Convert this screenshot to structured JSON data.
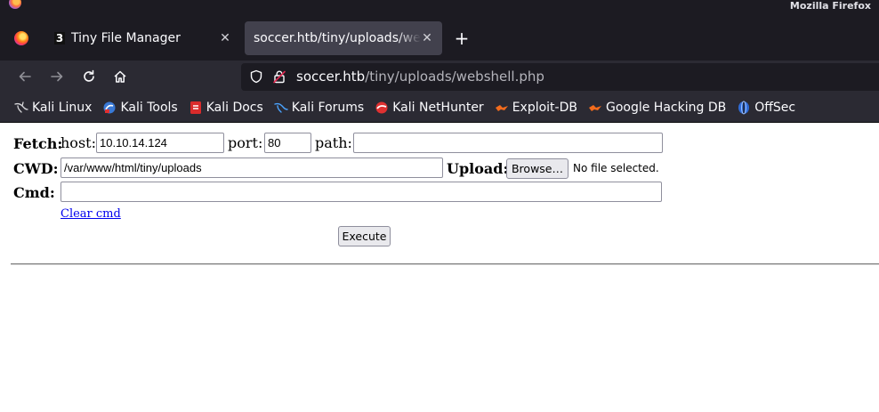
{
  "browser": {
    "app_title": "Mozilla Firefox",
    "tabs": [
      {
        "label": "Tiny File Manager",
        "favicon": "3",
        "active": false
      },
      {
        "label": "soccer.htb/tiny/uploads/webshell.php",
        "active": true
      }
    ],
    "url_host": "soccer.htb",
    "url_path": "/tiny/uploads/webshell.php",
    "bookmarks": [
      {
        "label": "Kali Linux",
        "icon": "kali-dragon-icon"
      },
      {
        "label": "Kali Tools",
        "icon": "kali-tools-icon"
      },
      {
        "label": "Kali Docs",
        "icon": "kali-docs-icon"
      },
      {
        "label": "Kali Forums",
        "icon": "kali-forums-icon"
      },
      {
        "label": "Kali NetHunter",
        "icon": "nethunter-icon"
      },
      {
        "label": "Exploit-DB",
        "icon": "exploit-db-icon"
      },
      {
        "label": "Google Hacking DB",
        "icon": "ghdb-icon"
      },
      {
        "label": "OffSec",
        "icon": "offsec-icon"
      }
    ],
    "colors": {
      "chrome_dark": "#1c1b22",
      "toolbar": "#2b2a33",
      "active_tab": "#42414d"
    }
  },
  "page": {
    "fetch_label": "Fetch:",
    "host_label": "host:",
    "host_value": "10.10.14.124",
    "port_label": "port:",
    "port_value": "80",
    "path_label": "path:",
    "path_value": "",
    "cwd_label": "CWD:",
    "cwd_value": "/var/www/html/tiny/uploads",
    "upload_label": "Upload:",
    "browse_label": "Browse…",
    "no_file_text": "No file selected.",
    "cmd_label": "Cmd:",
    "cmd_value": "",
    "clear_cmd_label": "Clear cmd",
    "execute_label": "Execute"
  }
}
